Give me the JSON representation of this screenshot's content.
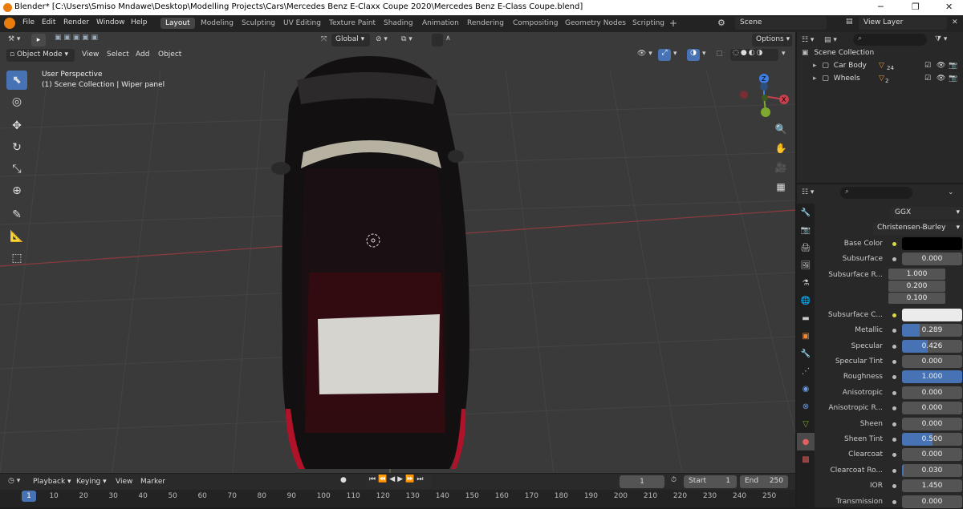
{
  "window": {
    "title": "Blender* [C:\\Users\\Smiso Mndawe\\Desktop\\Modelling Projects\\Cars\\Mercedes Benz E-Claxx Coupe 2020\\Mercedes Benz E-Class Coupe.blend]"
  },
  "menu": [
    "File",
    "Edit",
    "Render",
    "Window",
    "Help"
  ],
  "workspaces": [
    "Layout",
    "Modeling",
    "Sculpting",
    "UV Editing",
    "Texture Paint",
    "Shading",
    "Animation",
    "Rendering",
    "Compositing",
    "Geometry Nodes",
    "Scripting"
  ],
  "scene": {
    "label": "Scene"
  },
  "view_layer": {
    "label": "View Layer"
  },
  "viewport": {
    "transform_orientation": "Global",
    "options_label": "Options",
    "mode": "Object Mode",
    "header_menu": [
      "View",
      "Select",
      "Add",
      "Object"
    ],
    "info_line1": "User Perspective",
    "info_line2": "(1) Scene Collection | Wiper panel",
    "gizmo_axes": {
      "x": "X",
      "y": "Y",
      "z": "Z"
    }
  },
  "outliner": {
    "root": "Scene Collection",
    "items": [
      {
        "name": "Car Body",
        "count": "24"
      },
      {
        "name": "Wheels",
        "count": "2"
      }
    ]
  },
  "properties": {
    "distribution": "GGX",
    "subsurface_method": "Christensen-Burley",
    "rows": [
      {
        "label": "Base Color",
        "type": "color",
        "color": "#000000"
      },
      {
        "label": "Subsurface",
        "value": "0.000",
        "fill": 0
      },
      {
        "label": "Subsurface R...",
        "type": "vector",
        "values": [
          "1.000",
          "0.200",
          "0.100"
        ]
      },
      {
        "label": "Subsurface C...",
        "type": "color",
        "color": "#ebebeb"
      },
      {
        "label": "Metallic",
        "value": "0.289",
        "fill": 0.289
      },
      {
        "label": "Specular",
        "value": "0.426",
        "fill": 0.426
      },
      {
        "label": "Specular Tint",
        "value": "0.000",
        "fill": 0
      },
      {
        "label": "Roughness",
        "value": "1.000",
        "fill": 1
      },
      {
        "label": "Anisotropic",
        "value": "0.000",
        "fill": 0
      },
      {
        "label": "Anisotropic R...",
        "value": "0.000",
        "fill": 0
      },
      {
        "label": "Sheen",
        "value": "0.000",
        "fill": 0
      },
      {
        "label": "Sheen Tint",
        "value": "0.500",
        "fill": 0.5
      },
      {
        "label": "Clearcoat",
        "value": "0.000",
        "fill": 0
      },
      {
        "label": "Clearcoat Ro...",
        "value": "0.030",
        "fill": 0.03
      },
      {
        "label": "IOR",
        "value": "1.450",
        "fill": 0
      },
      {
        "label": "Transmission",
        "value": "0.000",
        "fill": 0
      }
    ]
  },
  "timeline": {
    "menus": [
      "Playback",
      "Keying",
      "View",
      "Marker"
    ],
    "current_frame": "1",
    "start_label": "Start",
    "start": "1",
    "end_label": "End",
    "end": "250",
    "ticks": [
      "1",
      "10",
      "20",
      "30",
      "40",
      "50",
      "60",
      "70",
      "80",
      "90",
      "100",
      "110",
      "120",
      "130",
      "140",
      "150",
      "160",
      "170",
      "180",
      "190",
      "200",
      "210",
      "220",
      "230",
      "240",
      "250"
    ]
  },
  "colors": {
    "accent": "#4772b3",
    "x_axis": "#c8404c",
    "y_axis": "#7ea82f",
    "z_axis": "#3d7fe5"
  }
}
